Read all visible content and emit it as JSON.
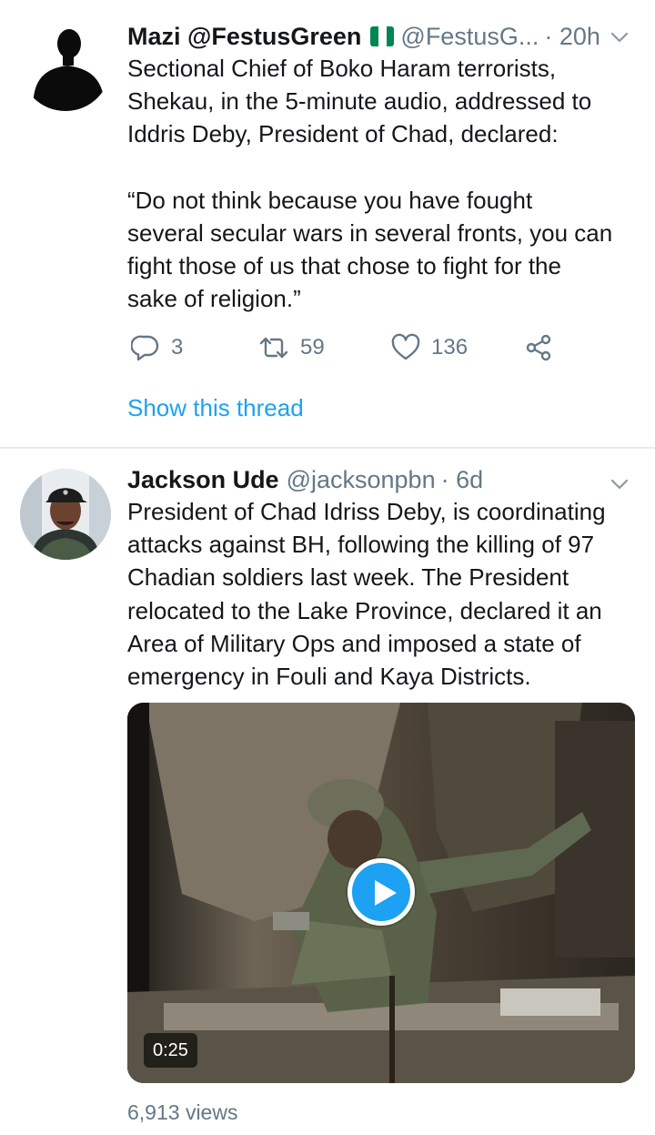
{
  "tweets": [
    {
      "name": "Mazi @FestusGreen",
      "handle": "@FestusG...",
      "time": "· 20h",
      "flag_colors": [
        "#008751",
        "#ffffff",
        "#008751"
      ],
      "text": [
        "Sectional Chief of Boko Haram terrorists,\nShekau, in the 5-minute audio, addressed to\nIddris Deby, President of Chad, declared:",
        "“Do not think because you have fought\nseveral secular wars in several fronts, you can\nfight those of us that chose to fight for the\nsake of religion.”"
      ],
      "replies": "3",
      "retweets": "59",
      "likes": "136",
      "show_thread": "Show this thread"
    },
    {
      "name": "Jackson Ude",
      "handle": "@jacksonpbn",
      "time": "· 6d",
      "text": [
        "President of Chad Idriss Deby, is coordinating\nattacks against BH, following the killing of 97\nChadian soldiers last week. The President\nrelocated to the Lake Province, declared it an\nArea of Military Ops and imposed a state of\nemergency in Fouli and Kaya Districts."
      ],
      "video": {
        "duration": "0:25",
        "views": "6,913 views"
      }
    }
  ],
  "icons": {
    "reply": "reply-icon",
    "retweet": "retweet-icon",
    "like": "heart-icon",
    "share": "share-icon",
    "caret": "chevron-down-icon",
    "play": "play-icon"
  },
  "colors": {
    "accent": "#1da1f2",
    "secondary_text": "#657786",
    "divider": "#e6ecf0",
    "flag_green": "#008751"
  }
}
